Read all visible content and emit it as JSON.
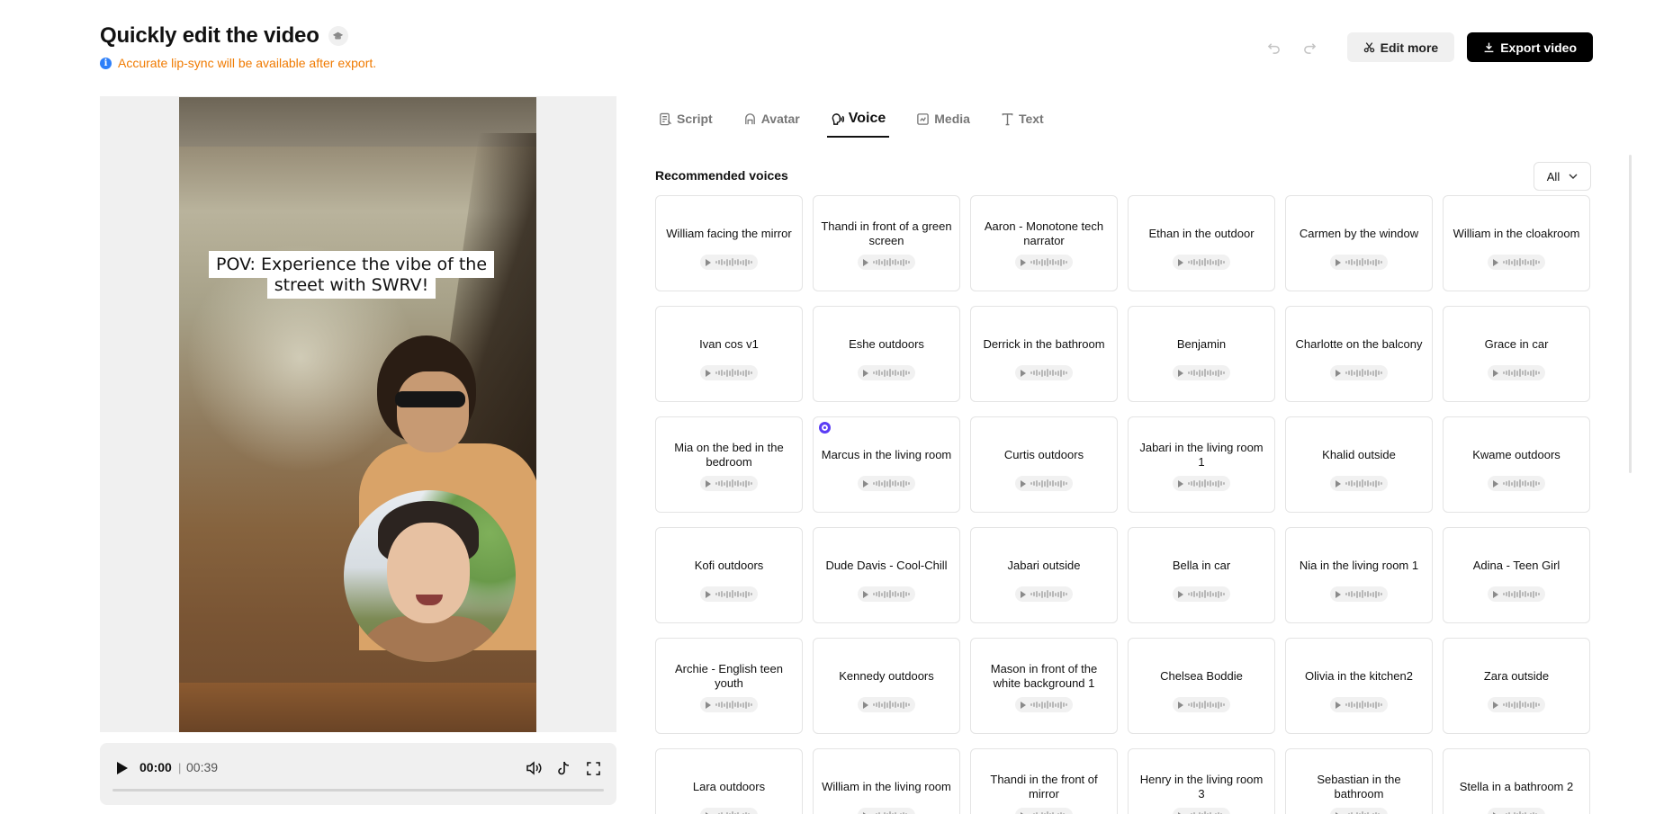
{
  "header": {
    "title": "Quickly edit the video",
    "notice": "Accurate lip-sync will be available after export.",
    "edit_more_label": "Edit more",
    "export_label": "Export video"
  },
  "preview": {
    "caption": "POV: Experience the vibe of the street with SWRV!"
  },
  "player": {
    "current_time": "00:00",
    "separator": "|",
    "total_time": "00:39",
    "progress": 0
  },
  "tabs": [
    {
      "label": "Script",
      "icon": "script-icon",
      "active": false
    },
    {
      "label": "Avatar",
      "icon": "avatar-icon",
      "active": false
    },
    {
      "label": "Voice",
      "icon": "voice-icon",
      "active": true
    },
    {
      "label": "Media",
      "icon": "media-icon",
      "active": false
    },
    {
      "label": "Text",
      "icon": "text-icon",
      "active": false
    }
  ],
  "voice_panel": {
    "section_title": "Recommended voices",
    "filter_value": "All",
    "selected_index": 13,
    "voices": [
      "William facing the mirror",
      "Thandi in front of a green screen",
      "Aaron - Monotone tech narrator",
      "Ethan in the outdoor",
      "Carmen by the window",
      "William in the cloakroom",
      "Ivan cos v1",
      "Eshe outdoors",
      "Derrick in the bathroom",
      "Benjamin",
      "Charlotte on the balcony",
      "Grace in car",
      "Mia on the bed in the bedroom",
      "Marcus in the living room",
      "Curtis outdoors",
      "Jabari in the living room 1",
      "Khalid outside",
      "Kwame outdoors",
      "Kofi outdoors",
      "Dude Davis - Cool-Chill",
      "Jabari outside",
      "Bella in car",
      "Nia in the living room 1",
      "Adina - Teen Girl",
      "Archie - English teen youth",
      "Kennedy outdoors",
      "Mason in front of the white background 1",
      "Chelsea Boddie",
      "Olivia in the kitchen2",
      "Zara outside",
      "Lara outdoors",
      "William in the living room",
      "Thandi in the front of mirror",
      "Henry in the living room 3",
      "Sebastian in the bathroom",
      "Stella in a bathroom 2"
    ]
  },
  "colors": {
    "accent": "#5b3df5",
    "notice": "#f07a00",
    "info": "#2d7ff9",
    "export_bg": "#000000"
  }
}
